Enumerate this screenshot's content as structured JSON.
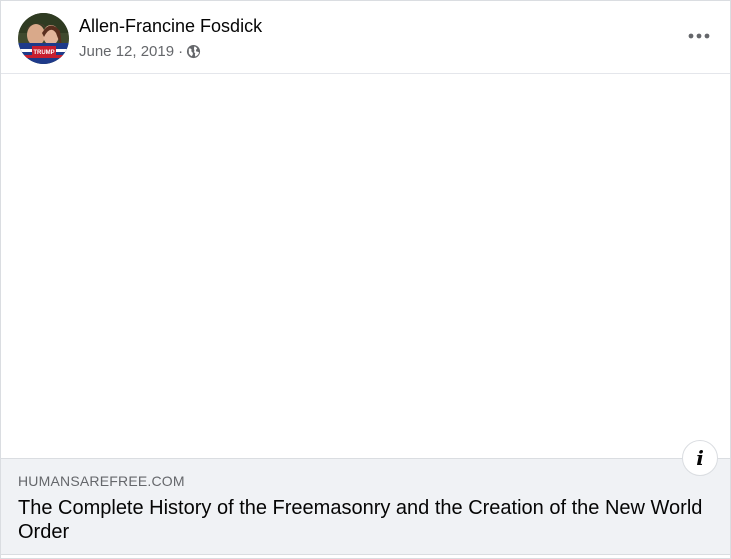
{
  "post": {
    "author_name": "Allen-Francine Fosdick",
    "date": "June 12, 2019",
    "separator": "·",
    "privacy_icon": "globe-icon",
    "more_icon": "more-horizontal-icon",
    "avatar_badge": "TRUMP"
  },
  "link_preview": {
    "domain": "HUMANSAREFREE.COM",
    "title": "The Complete History of the Freemasonry and the Creation of the New World Order",
    "info_icon": "info-icon",
    "info_glyph": "i"
  },
  "colors": {
    "primary_text": "#050505",
    "secondary_text": "#65676b",
    "preview_bg": "#f0f2f5",
    "divider": "#dadde1"
  }
}
